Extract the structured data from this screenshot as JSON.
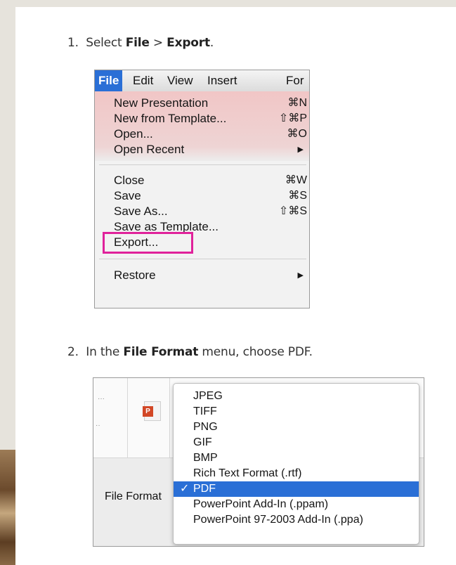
{
  "step1": {
    "num": "1.",
    "pre": "Select ",
    "file": "File",
    "mid": " > ",
    "export": "Export",
    "end": "."
  },
  "menubar": [
    "File",
    "Edit",
    "View",
    "Insert",
    "For"
  ],
  "menu_items": [
    {
      "label": "New Presentation",
      "shortcut": "⌘N"
    },
    {
      "label": "New from Template...",
      "shortcut": "⇧⌘P"
    },
    {
      "label": "Open...",
      "shortcut": "⌘O"
    },
    {
      "label": "Open Recent",
      "shortcut": "▶"
    },
    {
      "label": "Close",
      "shortcut": "⌘W"
    },
    {
      "label": "Save",
      "shortcut": "⌘S"
    },
    {
      "label": "Save As...",
      "shortcut": "⇧⌘S"
    },
    {
      "label": "Save as Template...",
      "shortcut": ""
    },
    {
      "label": "Export...",
      "shortcut": ""
    },
    {
      "label": "Restore",
      "shortcut": "▶"
    }
  ],
  "step2": {
    "num": "2.",
    "pre": "In the ",
    "bold": "File Format",
    "post": " menu, choose PDF."
  },
  "format_label": "File Format",
  "ppt_icon_letter": "P",
  "check": "✓",
  "formats": [
    "JPEG",
    "TIFF",
    "PNG",
    "GIF",
    "BMP",
    "Rich Text Format (.rtf)",
    "PDF",
    "PowerPoint Add-In (.ppam)",
    "PowerPoint 97-2003 Add-In (.ppa)"
  ],
  "selected_format": "PDF",
  "colors": {
    "selection": "#2a6fd6",
    "highlight_box": "#e0229b",
    "menu_tint": "#f1c6c6"
  }
}
